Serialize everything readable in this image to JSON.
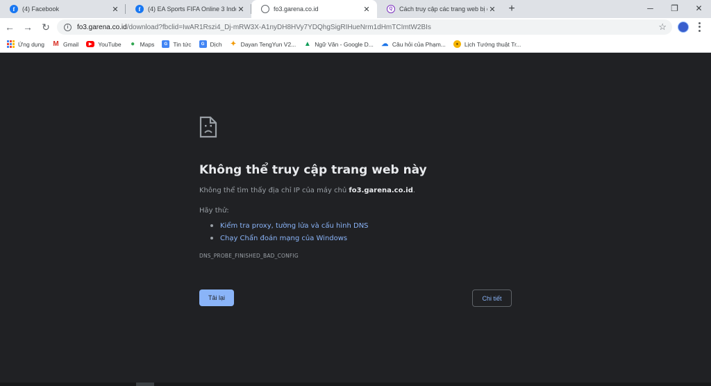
{
  "tabs": [
    {
      "title": "(4) Facebook",
      "favicon": "facebook-icon",
      "active": false
    },
    {
      "title": "(4) EA Sports FIFA Online 3 Indon",
      "favicon": "facebook-icon",
      "active": false
    },
    {
      "title": "fo3.garena.co.id",
      "favicon": "globe-icon",
      "active": true
    },
    {
      "title": "Cách truy cập các trang web bị ch",
      "favicon": "quora-icon",
      "active": false
    }
  ],
  "toolbar": {
    "url_host": "fo3.garena.co.id",
    "url_path": "/download?fbclid=IwAR1Rszi4_Dj-mRW3X-A1nyDH8HVy7YDQhgSigRIHueNrm1dHmTCImtW2BIs"
  },
  "bookmarks": [
    {
      "label": "Ứng dụng",
      "icon": "apps-icon"
    },
    {
      "label": "Gmail",
      "icon": "gmail-icon"
    },
    {
      "label": "YouTube",
      "icon": "youtube-icon"
    },
    {
      "label": "Maps",
      "icon": "maps-icon"
    },
    {
      "label": "Tin tức",
      "icon": "news-icon"
    },
    {
      "label": "Dịch",
      "icon": "translate-icon"
    },
    {
      "label": "Dayan TengYun V2...",
      "icon": "dayan-icon"
    },
    {
      "label": "Ngữ Văn - Google D...",
      "icon": "google-drive-icon"
    },
    {
      "label": "Câu hỏi của Phạm...",
      "icon": "cloud-icon"
    },
    {
      "label": "Lịch Tướng thuật Tr...",
      "icon": "lich-icon"
    }
  ],
  "error": {
    "title": "Không thể truy cập trang web này",
    "desc_prefix": "Không thể tìm thấy địa chỉ IP của máy chủ ",
    "desc_host": "fo3.garena.co.id",
    "desc_suffix": ".",
    "try_label": "Hãy thử:",
    "suggestions": [
      "Kiểm tra proxy, tường lửa và cấu hình DNS",
      "Chạy Chẩn đoán mạng của Windows"
    ],
    "code": "DNS_PROBE_FINISHED_BAD_CONFIG",
    "reload_label": "Tải lại",
    "details_label": "Chi tiết"
  },
  "colors": {
    "page_bg": "#202124",
    "link": "#8ab4f8",
    "primary_button": "#8ab4f8"
  }
}
